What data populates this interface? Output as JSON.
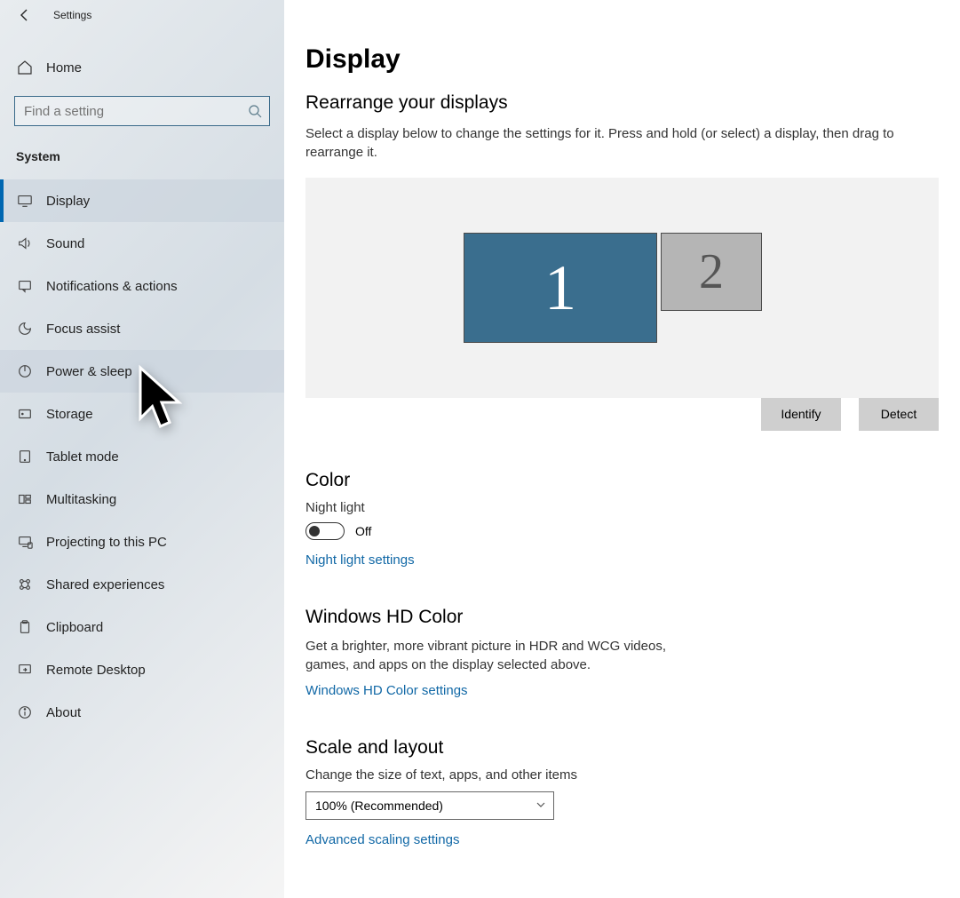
{
  "app_title": "Settings",
  "home_label": "Home",
  "search_placeholder": "Find a setting",
  "category_label": "System",
  "nav": [
    {
      "key": "display",
      "label": "Display",
      "active": true
    },
    {
      "key": "sound",
      "label": "Sound"
    },
    {
      "key": "notifications",
      "label": "Notifications & actions"
    },
    {
      "key": "focus-assist",
      "label": "Focus assist"
    },
    {
      "key": "power-sleep",
      "label": "Power & sleep",
      "hover": true
    },
    {
      "key": "storage",
      "label": "Storage"
    },
    {
      "key": "tablet-mode",
      "label": "Tablet mode"
    },
    {
      "key": "multitasking",
      "label": "Multitasking"
    },
    {
      "key": "projecting",
      "label": "Projecting to this PC"
    },
    {
      "key": "shared-experiences",
      "label": "Shared experiences"
    },
    {
      "key": "clipboard",
      "label": "Clipboard"
    },
    {
      "key": "remote-desktop",
      "label": "Remote Desktop"
    },
    {
      "key": "about",
      "label": "About"
    }
  ],
  "main": {
    "title": "Display",
    "rearrange": {
      "heading": "Rearrange your displays",
      "description": "Select a display below to change the settings for it. Press and hold (or select) a display, then drag to rearrange it.",
      "monitors": {
        "primary": "1",
        "secondary": "2"
      },
      "identify_btn": "Identify",
      "detect_btn": "Detect"
    },
    "color": {
      "heading": "Color",
      "night_light_label": "Night light",
      "night_light_state": "Off",
      "night_light_settings_link": "Night light settings"
    },
    "hd_color": {
      "heading": "Windows HD Color",
      "description": "Get a brighter, more vibrant picture in HDR and WCG videos, games, and apps on the display selected above.",
      "link": "Windows HD Color settings"
    },
    "scale": {
      "heading": "Scale and layout",
      "label": "Change the size of text, apps, and other items",
      "value": "100% (Recommended)",
      "link": "Advanced scaling settings"
    }
  }
}
